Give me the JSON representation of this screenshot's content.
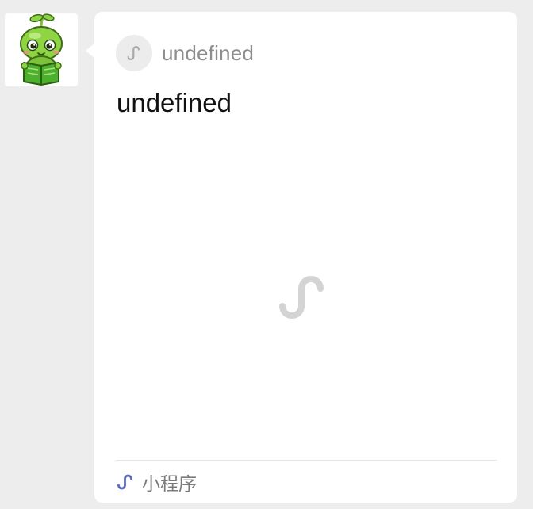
{
  "sender": {
    "avatar_icon": "green-sprout-mascot-reading-book-icon"
  },
  "card": {
    "app_icon": "mini-program-link-icon",
    "app_name": "undefined",
    "title": "undefined",
    "preview_icon": "mini-program-placeholder-icon",
    "footer_icon": "mini-program-icon",
    "footer_label": "小程序",
    "colors": {
      "background": "#ffffff",
      "footer_icon": "#5b6bbd",
      "placeholder_icon": "#d4d4d4",
      "page_background": "#ededed"
    }
  }
}
